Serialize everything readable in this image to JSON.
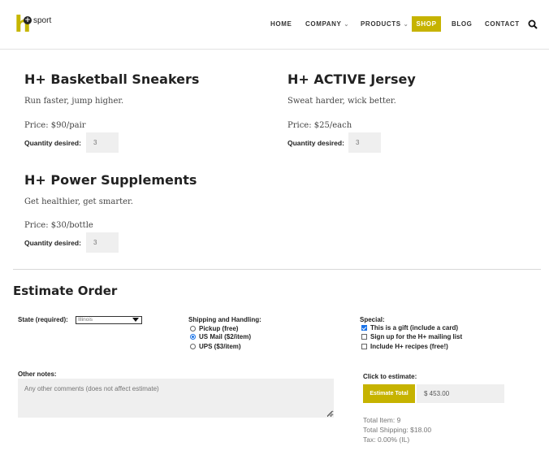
{
  "brand": {
    "logo_letter": "h",
    "logo_plus": "+",
    "logo_word": "sport",
    "accent": "#c6b300"
  },
  "nav": {
    "home": "HOME",
    "company": "COMPANY",
    "products": "PRODUCTS",
    "shop": "SHOP",
    "blog": "BLOG",
    "contact": "CONTACT",
    "caret": "⌄"
  },
  "products": [
    {
      "title": "H+ Basketball Sneakers",
      "description": "Run faster, jump higher.",
      "price": "Price: $90/pair",
      "qty_label": "Quantity desired:",
      "qty_value": "3"
    },
    {
      "title": "H+ ACTIVE Jersey",
      "description": "Sweat harder, wick better.",
      "price": "Price: $25/each",
      "qty_label": "Quantity desired:",
      "qty_value": "3"
    },
    {
      "title": "H+ Power Supplements",
      "description": "Get healthier, get smarter.",
      "price": "Price: $30/bottle",
      "qty_label": "Quantity desired:",
      "qty_value": "3"
    }
  ],
  "estimate": {
    "title": "Estimate Order",
    "state_label": "State (required):",
    "state_value": "Illinois",
    "shipping_label": "Shipping and Handling:",
    "shipping_options": [
      {
        "label": "Pickup (free)",
        "selected": false
      },
      {
        "label": "US Mail ($2/item)",
        "selected": true
      },
      {
        "label": "UPS ($3/item)",
        "selected": false
      }
    ],
    "special_label": "Special:",
    "special_options": [
      {
        "label": "This is a gift (include a card)",
        "checked": true
      },
      {
        "label": "Sign up for the H+ mailing list",
        "checked": false
      },
      {
        "label": "Include H+ recipes (free!)",
        "checked": false
      }
    ],
    "notes_label": "Other notes:",
    "notes_placeholder": "Any other comments (does not affect estimate)",
    "click_label": "Click to estimate:",
    "button_label": "Estimate Total",
    "total_value": "$ 453.00",
    "total_item": "Total Item: 9",
    "total_shipping": "Total Shipping: $18.00",
    "tax": "Tax: 0.00% (IL)"
  }
}
